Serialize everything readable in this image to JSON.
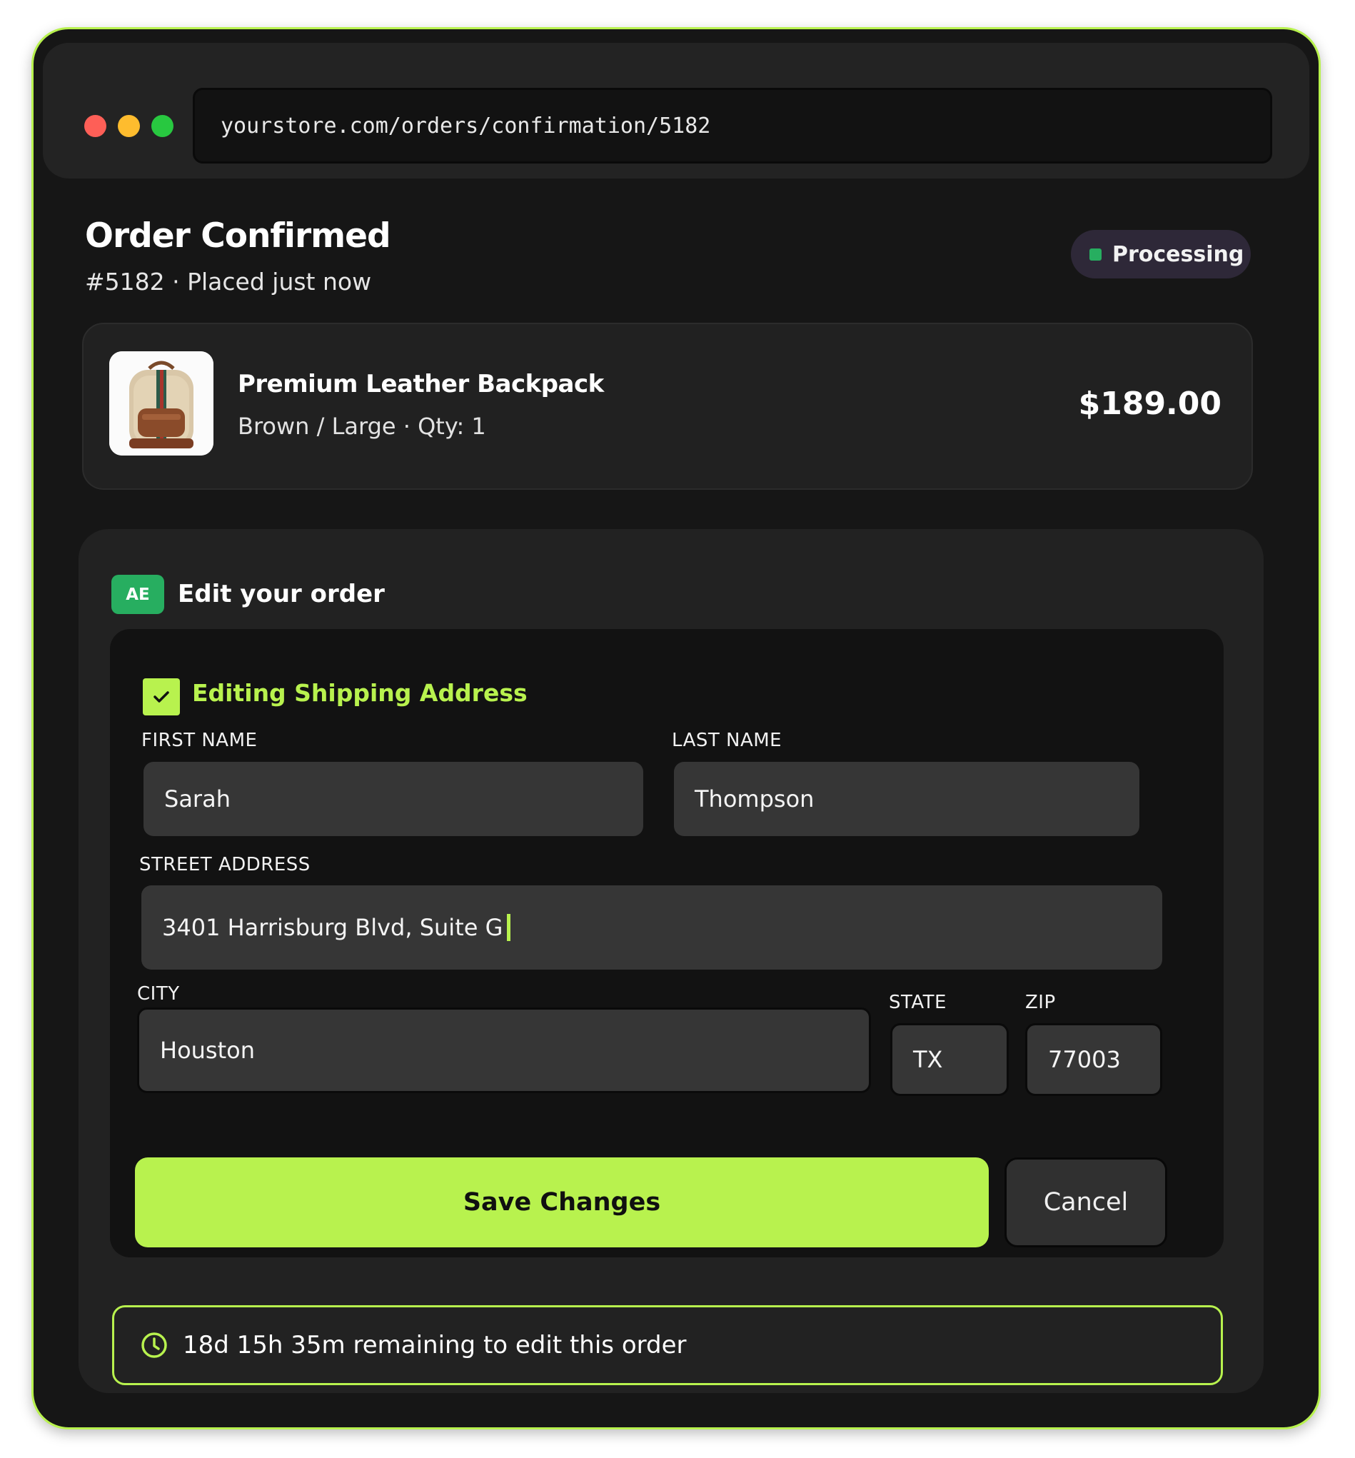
{
  "browser": {
    "url": "yourstore.com/orders/confirmation/5182"
  },
  "order": {
    "title": "Order Confirmed",
    "subtitle": "#5182 · Placed just now",
    "status": "Processing",
    "status_color": "#27ae60"
  },
  "product": {
    "name": "Premium Leather Backpack",
    "meta": "Brown / Large · Qty: 1",
    "price": "$189.00"
  },
  "edit": {
    "badge": "AE",
    "heading": "Edit your order",
    "section_label": "Editing Shipping Address",
    "section_checked": true,
    "fields": {
      "first_name": {
        "label": "FIRST NAME",
        "value": "Sarah"
      },
      "last_name": {
        "label": "LAST NAME",
        "value": "Thompson"
      },
      "street": {
        "label": "STREET ADDRESS",
        "value": "3401 Harrisburg Blvd, Suite G"
      },
      "city": {
        "label": "CITY",
        "value": "Houston"
      },
      "state": {
        "label": "STATE",
        "value": "TX"
      },
      "zip": {
        "label": "ZIP",
        "value": "77003"
      }
    },
    "save_label": "Save Changes",
    "cancel_label": "Cancel",
    "timer_text": "18d 15h 35m remaining to edit this order"
  },
  "colors": {
    "accent": "#b8f24e",
    "background": "#161616"
  },
  "icons": {
    "status": "square-dot-icon",
    "checkbox": "check-icon",
    "timer": "clock-icon"
  }
}
